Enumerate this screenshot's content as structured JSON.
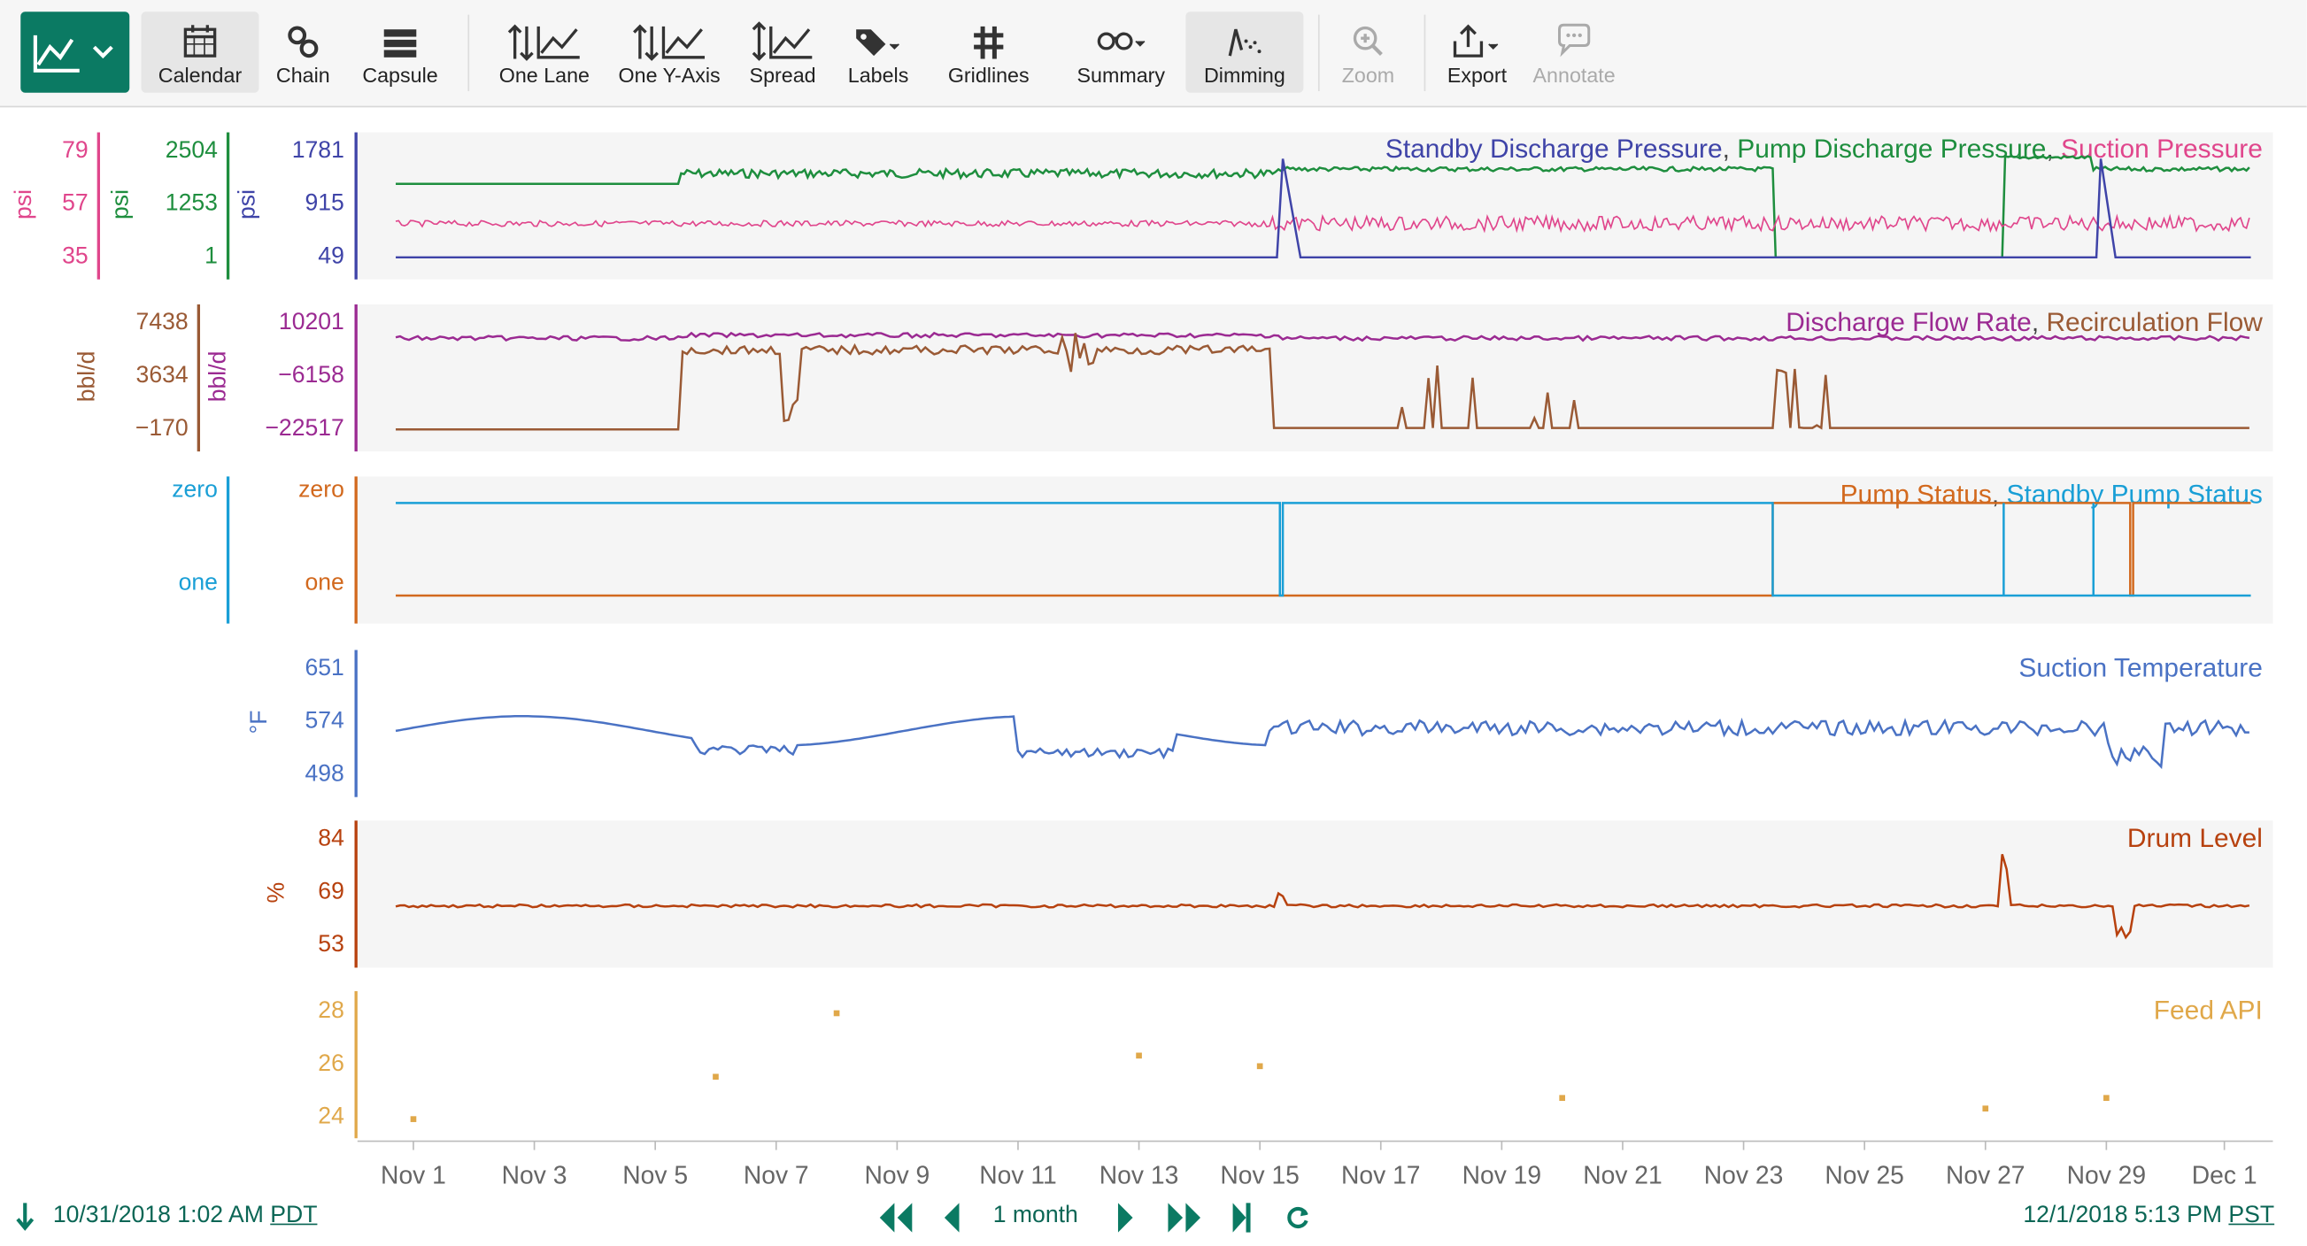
{
  "toolbar": {
    "items": [
      {
        "label": "Calendar",
        "icon": "calendar-icon"
      },
      {
        "label": "Chain",
        "icon": "chain-link-icon"
      },
      {
        "label": "Capsule",
        "icon": "capsule-icon"
      },
      {
        "label": "One Lane",
        "icon": "one-lane-icon"
      },
      {
        "label": "One Y-Axis",
        "icon": "one-y-axis-icon"
      },
      {
        "label": "Spread",
        "icon": "spread-icon"
      },
      {
        "label": "Labels",
        "icon": "tag-icon"
      },
      {
        "label": "Gridlines",
        "icon": "grid-icon"
      },
      {
        "label": "Summary",
        "icon": "binoculars-icon"
      },
      {
        "label": "Dimming",
        "icon": "dimming-icon"
      },
      {
        "label": "Zoom",
        "icon": "magnifier-plus-icon"
      },
      {
        "label": "Export",
        "icon": "export-icon"
      },
      {
        "label": "Annotate",
        "icon": "speech-bubble-icon"
      }
    ]
  },
  "lanes": {
    "pressure": {
      "title_parts": [
        "Standby Discharge Pressure",
        ", ",
        "Pump Discharge Pressure",
        ", ",
        "Suction Pressure"
      ],
      "axes": [
        {
          "unit": "psi",
          "ticks": [
            "79",
            "57",
            "35"
          ],
          "color": "#e0468c"
        },
        {
          "unit": "psi",
          "ticks": [
            "2504",
            "1253",
            "1"
          ],
          "color": "#1e8e3e"
        },
        {
          "unit": "psi",
          "ticks": [
            "1781",
            "915",
            "49"
          ],
          "color": "#3f44a8"
        }
      ]
    },
    "flow": {
      "title_parts": [
        "Discharge Flow Rate",
        ", ",
        "Recirculation Flow"
      ],
      "axes": [
        {
          "unit": "bbl/d",
          "ticks": [
            "7438",
            "3634",
            "−170"
          ],
          "color": "#9a5a35"
        },
        {
          "unit": "bbl/d",
          "ticks": [
            "10201",
            "−6158",
            "−22517"
          ],
          "color": "#9b2a92"
        }
      ]
    },
    "status": {
      "title_parts": [
        "Pump Status",
        ", ",
        "Standby Pump Status"
      ],
      "axes": [
        {
          "unit": "",
          "ticks": [
            "zero",
            "one"
          ],
          "color": "#1a9fd6"
        },
        {
          "unit": "",
          "ticks": [
            "zero",
            "one"
          ],
          "color": "#d2691e"
        }
      ]
    },
    "temperature": {
      "title": "Suction Temperature",
      "axis": {
        "unit": "°F",
        "ticks": [
          "651",
          "574",
          "498"
        ],
        "color": "#4a72c4"
      }
    },
    "drum": {
      "title": "Drum Level",
      "axis": {
        "unit": "%",
        "ticks": [
          "84",
          "69",
          "53"
        ],
        "color": "#b7410e"
      }
    },
    "api": {
      "title": "Feed API",
      "axis": {
        "unit": "",
        "ticks": [
          "28",
          "26",
          "24"
        ],
        "color": "#e0a84a"
      }
    }
  },
  "x_axis": {
    "ticks": [
      "Nov 1",
      "Nov 3",
      "Nov 5",
      "Nov 7",
      "Nov 9",
      "Nov 11",
      "Nov 13",
      "Nov 15",
      "Nov 17",
      "Nov 19",
      "Nov 21",
      "Nov 23",
      "Nov 25",
      "Nov 27",
      "Nov 29",
      "Dec 1"
    ]
  },
  "footer": {
    "start_time": "10/31/2018 1:02 AM",
    "start_tz": "PDT",
    "range_label": "1 month",
    "end_time": "12/1/2018 5:13 PM",
    "end_tz": "PST"
  },
  "colors": {
    "brand": "#0b7a63"
  },
  "chart_data": {
    "type": "line",
    "x_range": [
      "Oct 31 2018",
      "Dec 1 2018"
    ],
    "series": [
      {
        "name": "Standby Discharge Pressure",
        "unit": "psi",
        "approx": "~49 until Nov 15, jumps to ~1781 Nov 15 to Nov 29, back to ~49"
      },
      {
        "name": "Pump Discharge Pressure",
        "unit": "psi",
        "approx": "~2350 baseline, drops near 1 Nov 23-Nov 27, returns ~2350"
      },
      {
        "name": "Suction Pressure",
        "unit": "psi",
        "approx": "~60 noisy"
      },
      {
        "name": "Discharge Flow Rate",
        "unit": "bbl/d",
        "approx": "~10201 high steady"
      },
      {
        "name": "Recirculation Flow",
        "unit": "bbl/d",
        "approx": "-170 baseline with ~6500 plateau Nov 5-Nov 15"
      },
      {
        "name": "Pump Status",
        "values": [
          "one"
        ],
        "approx": "one, switches zero after Nov 23"
      },
      {
        "name": "Standby Pump Status",
        "approx": "zero until Nov 23, then one"
      },
      {
        "name": "Suction Temperature",
        "unit": "°F",
        "approx": "~540-580 oscillating"
      },
      {
        "name": "Drum Level",
        "unit": "%",
        "approx": "~66 steady with spikes"
      },
      {
        "name": "Feed API",
        "points": [
          [
            "Nov 1",
            24.0
          ],
          [
            "Nov 6",
            25.6
          ],
          [
            "Nov 8",
            28.0
          ],
          [
            "Nov 13",
            26.4
          ],
          [
            "Nov 15",
            26.0
          ],
          [
            "Nov 20",
            24.8
          ],
          [
            "Nov 27",
            24.4
          ],
          [
            "Nov 29",
            24.8
          ]
        ]
      }
    ]
  }
}
